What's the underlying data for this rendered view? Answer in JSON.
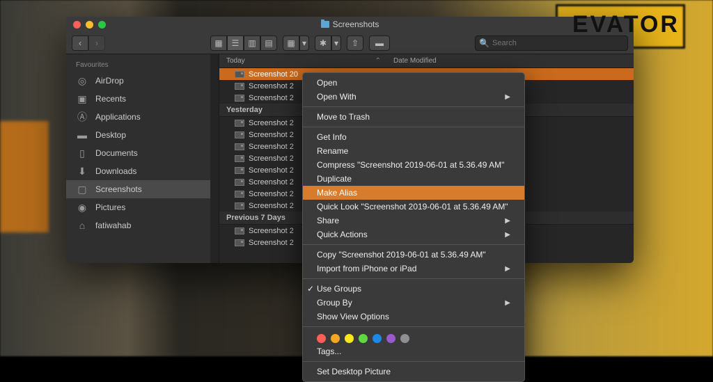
{
  "bg": {
    "sign_text": "EVATOR"
  },
  "window": {
    "title": "Screenshots",
    "toolbar": {
      "search_placeholder": "Search"
    },
    "sidebar": {
      "header": "Favourites",
      "items": [
        {
          "label": "AirDrop",
          "icon": "airdrop"
        },
        {
          "label": "Recents",
          "icon": "recents"
        },
        {
          "label": "Applications",
          "icon": "apps"
        },
        {
          "label": "Desktop",
          "icon": "desktop"
        },
        {
          "label": "Documents",
          "icon": "documents"
        },
        {
          "label": "Downloads",
          "icon": "downloads"
        },
        {
          "label": "Screenshots",
          "icon": "folder",
          "selected": true
        },
        {
          "label": "Pictures",
          "icon": "pictures"
        },
        {
          "label": "fatiwahab",
          "icon": "home"
        }
      ]
    },
    "columns": {
      "name": "Today",
      "date": "Date Modified"
    },
    "groups": [
      {
        "heading": "Today",
        "rows": [
          "Screenshot 20",
          "Screenshot 2",
          "Screenshot 2"
        ],
        "selected_index": 0
      },
      {
        "heading": "Yesterday",
        "rows": [
          "Screenshot 2",
          "Screenshot 2",
          "Screenshot 2",
          "Screenshot 2",
          "Screenshot 2",
          "Screenshot 2",
          "Screenshot 2",
          "Screenshot 2"
        ]
      },
      {
        "heading": "Previous 7 Days",
        "rows": [
          "Screenshot 2",
          "Screenshot 2"
        ]
      }
    ]
  },
  "context_menu": {
    "items": [
      {
        "label": "Open"
      },
      {
        "label": "Open With",
        "submenu": true
      },
      {
        "sep": true
      },
      {
        "label": "Move to Trash"
      },
      {
        "sep": true
      },
      {
        "label": "Get Info"
      },
      {
        "label": "Rename"
      },
      {
        "label": "Compress \"Screenshot 2019-06-01 at 5.36.49 AM\""
      },
      {
        "label": "Duplicate"
      },
      {
        "label": "Make Alias",
        "highlighted": true
      },
      {
        "label": "Quick Look \"Screenshot 2019-06-01 at 5.36.49 AM\""
      },
      {
        "label": "Share",
        "submenu": true
      },
      {
        "label": "Quick Actions",
        "submenu": true
      },
      {
        "sep": true
      },
      {
        "label": "Copy \"Screenshot 2019-06-01 at 5.36.49 AM\""
      },
      {
        "label": "Import from iPhone or iPad",
        "submenu": true
      },
      {
        "sep": true
      },
      {
        "label": "Use Groups",
        "checked": true
      },
      {
        "label": "Group By",
        "submenu": true
      },
      {
        "label": "Show View Options"
      },
      {
        "sep": true
      },
      {
        "tags": true
      },
      {
        "label": "Tags..."
      },
      {
        "sep": true
      },
      {
        "label": "Set Desktop Picture"
      }
    ],
    "tag_colors": [
      "#ff5f57",
      "#f5a623",
      "#f8e71c",
      "#62d840",
      "#1e88e5",
      "#9b59d0",
      "#8e8e93"
    ]
  }
}
